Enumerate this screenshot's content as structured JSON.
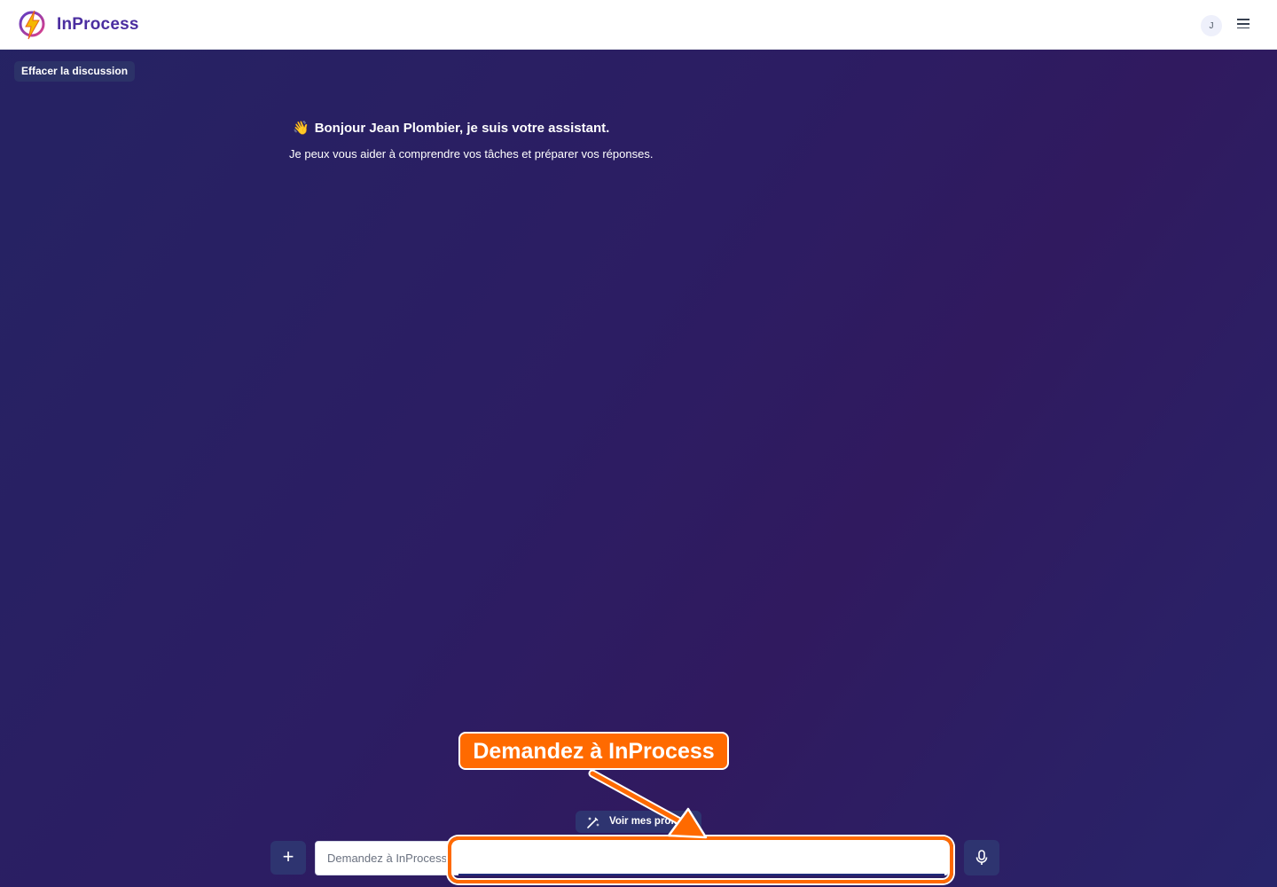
{
  "header": {
    "brand": "InProcess",
    "avatar_initial": "J"
  },
  "toolbar": {
    "clear_label": "Effacer la discussion"
  },
  "greeting": {
    "emoji": "👋",
    "title": "Bonjour Jean Plombier, je suis votre assistant.",
    "subtitle": "Je peux vous aider à comprendre vos tâches et préparer vos réponses."
  },
  "composer": {
    "prompts_label": "Voir mes prompts",
    "plus_symbol": "+",
    "input_placeholder": "Demandez à InProcess",
    "input_value": ""
  },
  "annotation": {
    "callout_text": "Demandez à InProcess",
    "color": "#ff6a00"
  },
  "colors": {
    "brand": "#4b2ea0",
    "background_start": "#252363",
    "background_mid": "#2f1a60",
    "button_bg": "#2e3470"
  }
}
